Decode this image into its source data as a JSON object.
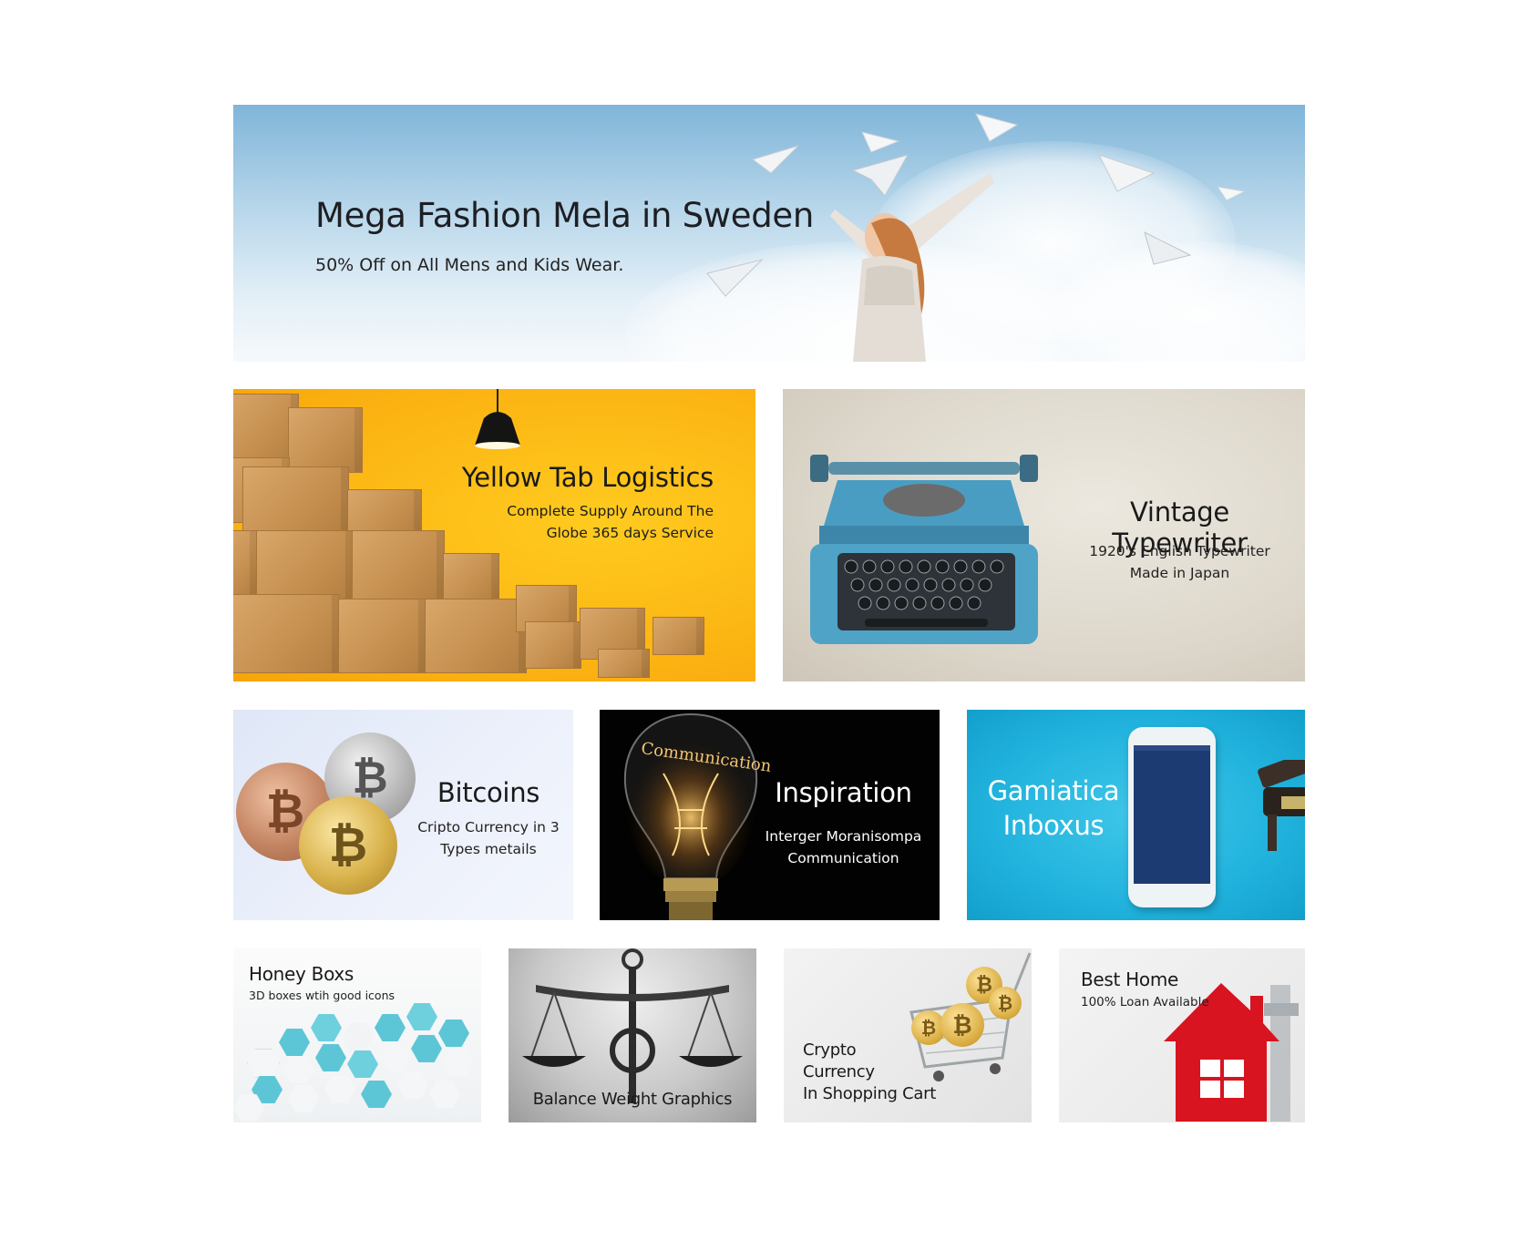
{
  "banners": {
    "fashion": {
      "title": "Mega Fashion Mela in Sweden",
      "subtitle": "50% Off on All Mens and Kids Wear."
    },
    "logistics": {
      "title": "Yellow Tab Logistics",
      "subtitle": "Complete Supply Around The Globe 365 days Service"
    },
    "typewriter": {
      "title": "Vintage Typewriter",
      "subtitle_line1": "1920's English Typewriter",
      "subtitle_line2": "Made in Japan"
    },
    "bitcoins": {
      "title": "Bitcoins",
      "subtitle": "Cripto Currency in 3 Types metails"
    },
    "inspiration": {
      "title": "Inspiration",
      "subtitle_line1": "Interger Moranisompa",
      "subtitle_line2": "Communication",
      "bulb_text": "Communication"
    },
    "gamiatica": {
      "title_line1": "Gamiatica",
      "title_line2": "Inboxus"
    },
    "honey": {
      "title": "Honey Boxs",
      "subtitle": "3D boxes wtih good icons"
    },
    "balance": {
      "title": "Balance Weight Graphics"
    },
    "crypto_cart": {
      "title_line1": "Crypto",
      "title_line2": "Currency",
      "title_line3": "In Shopping Cart"
    },
    "home": {
      "title": "Best Home",
      "subtitle": "100% Loan Available"
    }
  },
  "colors": {
    "logistics_bg": "#fcb614",
    "gamiatica_bg": "#21b3dd",
    "phone_screen": "#1c3b73",
    "house_red": "#d7141f"
  },
  "icons": [
    "bitcoin-icon",
    "pendant-lamp-icon",
    "gavel-icon",
    "house-icon",
    "paper-plane-icon"
  ]
}
